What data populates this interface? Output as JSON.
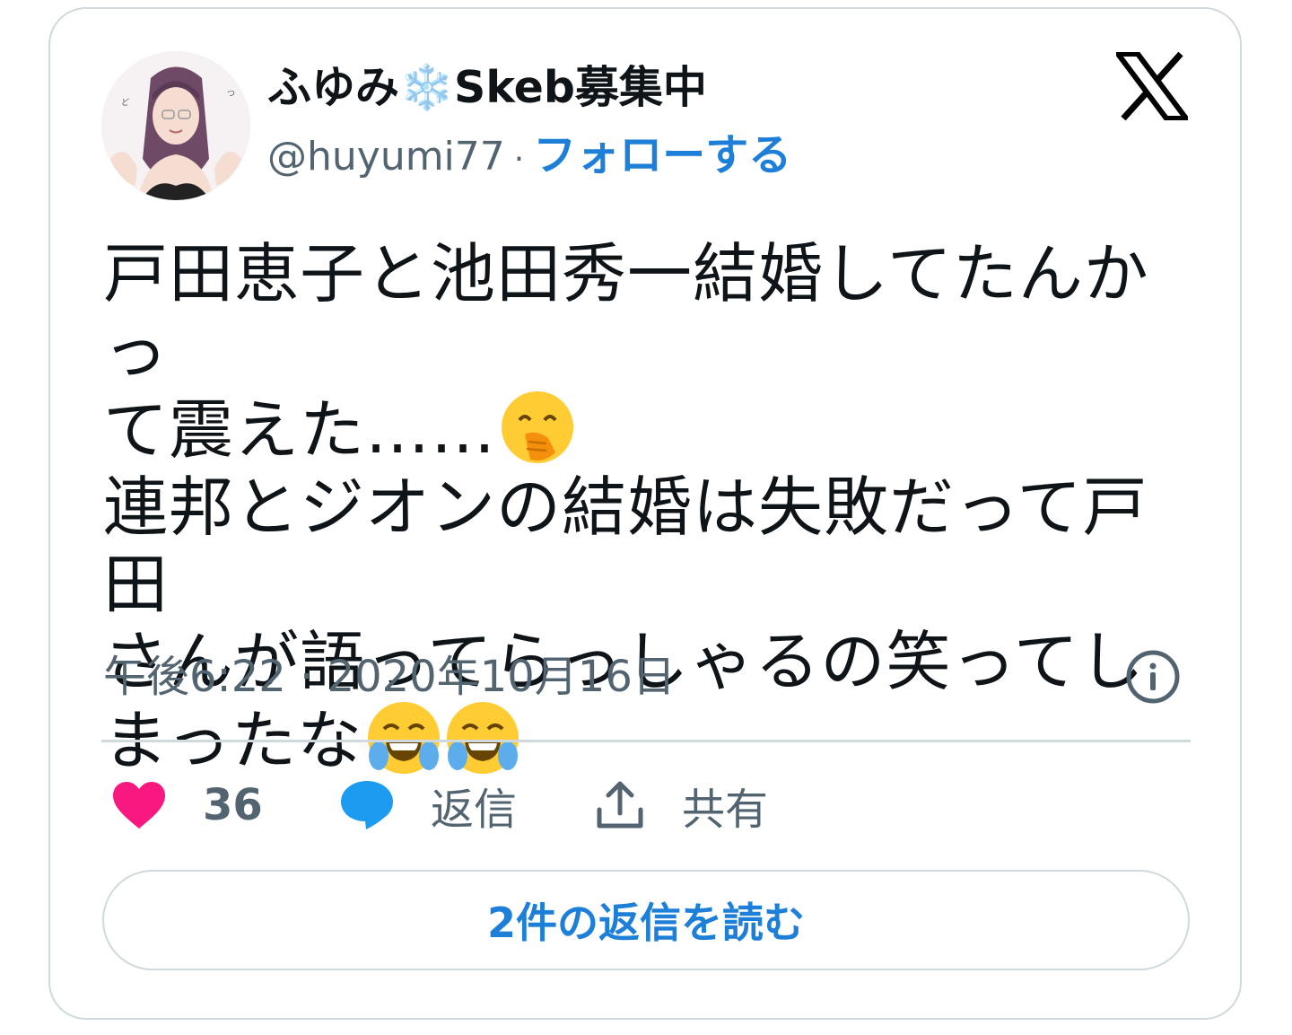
{
  "author": {
    "name_prefix": "ふゆみ",
    "name_snowflake": "❄️",
    "name_suffix": "Skeb募集中",
    "handle": "@huyumi77",
    "separator": "·",
    "follow_label": "フォローする"
  },
  "tweet": {
    "line1": "戸田恵子と池田秀一結婚してたんかっ",
    "line2": "て震えた……",
    "line3": "連邦とジオンの結婚は失敗だって戸田",
    "line4": "さんが語ってらっしゃるの笑ってし",
    "line5": "まったな",
    "emoji_1": "face-with-hand-over-mouth",
    "emoji_2": "face-with-tears-of-joy"
  },
  "timestamp": "午後6:22 · 2020年10月16日",
  "actions": {
    "like_count": "36",
    "reply_label": "返信",
    "share_label": "共有"
  },
  "read_replies_label": "2件の返信を読む",
  "colors": {
    "accent": "#1d7fd7",
    "like": "#f91880",
    "reply_bubble": "#1d9bf0",
    "muted": "#536471",
    "border": "#cfd9de"
  }
}
